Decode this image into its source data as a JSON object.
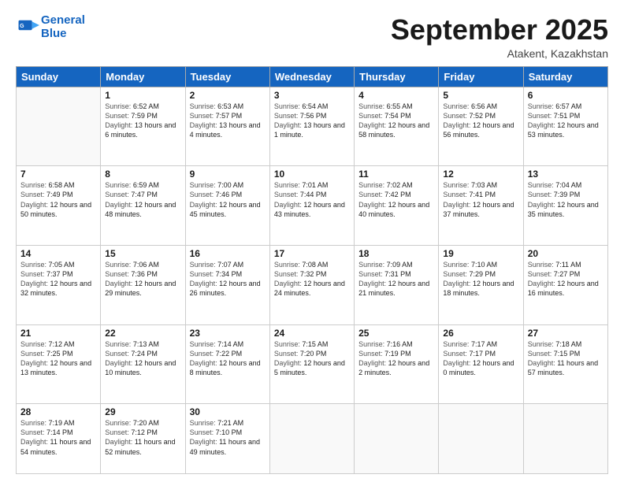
{
  "logo": {
    "line1": "General",
    "line2": "Blue"
  },
  "title": "September 2025",
  "subtitle": "Atakent, Kazakhstan",
  "weekdays": [
    "Sunday",
    "Monday",
    "Tuesday",
    "Wednesday",
    "Thursday",
    "Friday",
    "Saturday"
  ],
  "weeks": [
    [
      {
        "day": "",
        "sunrise": "",
        "sunset": "",
        "daylight": ""
      },
      {
        "day": "1",
        "sunrise": "6:52 AM",
        "sunset": "7:59 PM",
        "daylight": "13 hours and 6 minutes."
      },
      {
        "day": "2",
        "sunrise": "6:53 AM",
        "sunset": "7:57 PM",
        "daylight": "13 hours and 4 minutes."
      },
      {
        "day": "3",
        "sunrise": "6:54 AM",
        "sunset": "7:56 PM",
        "daylight": "13 hours and 1 minute."
      },
      {
        "day": "4",
        "sunrise": "6:55 AM",
        "sunset": "7:54 PM",
        "daylight": "12 hours and 58 minutes."
      },
      {
        "day": "5",
        "sunrise": "6:56 AM",
        "sunset": "7:52 PM",
        "daylight": "12 hours and 56 minutes."
      },
      {
        "day": "6",
        "sunrise": "6:57 AM",
        "sunset": "7:51 PM",
        "daylight": "12 hours and 53 minutes."
      }
    ],
    [
      {
        "day": "7",
        "sunrise": "6:58 AM",
        "sunset": "7:49 PM",
        "daylight": "12 hours and 50 minutes."
      },
      {
        "day": "8",
        "sunrise": "6:59 AM",
        "sunset": "7:47 PM",
        "daylight": "12 hours and 48 minutes."
      },
      {
        "day": "9",
        "sunrise": "7:00 AM",
        "sunset": "7:46 PM",
        "daylight": "12 hours and 45 minutes."
      },
      {
        "day": "10",
        "sunrise": "7:01 AM",
        "sunset": "7:44 PM",
        "daylight": "12 hours and 43 minutes."
      },
      {
        "day": "11",
        "sunrise": "7:02 AM",
        "sunset": "7:42 PM",
        "daylight": "12 hours and 40 minutes."
      },
      {
        "day": "12",
        "sunrise": "7:03 AM",
        "sunset": "7:41 PM",
        "daylight": "12 hours and 37 minutes."
      },
      {
        "day": "13",
        "sunrise": "7:04 AM",
        "sunset": "7:39 PM",
        "daylight": "12 hours and 35 minutes."
      }
    ],
    [
      {
        "day": "14",
        "sunrise": "7:05 AM",
        "sunset": "7:37 PM",
        "daylight": "12 hours and 32 minutes."
      },
      {
        "day": "15",
        "sunrise": "7:06 AM",
        "sunset": "7:36 PM",
        "daylight": "12 hours and 29 minutes."
      },
      {
        "day": "16",
        "sunrise": "7:07 AM",
        "sunset": "7:34 PM",
        "daylight": "12 hours and 26 minutes."
      },
      {
        "day": "17",
        "sunrise": "7:08 AM",
        "sunset": "7:32 PM",
        "daylight": "12 hours and 24 minutes."
      },
      {
        "day": "18",
        "sunrise": "7:09 AM",
        "sunset": "7:31 PM",
        "daylight": "12 hours and 21 minutes."
      },
      {
        "day": "19",
        "sunrise": "7:10 AM",
        "sunset": "7:29 PM",
        "daylight": "12 hours and 18 minutes."
      },
      {
        "day": "20",
        "sunrise": "7:11 AM",
        "sunset": "7:27 PM",
        "daylight": "12 hours and 16 minutes."
      }
    ],
    [
      {
        "day": "21",
        "sunrise": "7:12 AM",
        "sunset": "7:25 PM",
        "daylight": "12 hours and 13 minutes."
      },
      {
        "day": "22",
        "sunrise": "7:13 AM",
        "sunset": "7:24 PM",
        "daylight": "12 hours and 10 minutes."
      },
      {
        "day": "23",
        "sunrise": "7:14 AM",
        "sunset": "7:22 PM",
        "daylight": "12 hours and 8 minutes."
      },
      {
        "day": "24",
        "sunrise": "7:15 AM",
        "sunset": "7:20 PM",
        "daylight": "12 hours and 5 minutes."
      },
      {
        "day": "25",
        "sunrise": "7:16 AM",
        "sunset": "7:19 PM",
        "daylight": "12 hours and 2 minutes."
      },
      {
        "day": "26",
        "sunrise": "7:17 AM",
        "sunset": "7:17 PM",
        "daylight": "12 hours and 0 minutes."
      },
      {
        "day": "27",
        "sunrise": "7:18 AM",
        "sunset": "7:15 PM",
        "daylight": "11 hours and 57 minutes."
      }
    ],
    [
      {
        "day": "28",
        "sunrise": "7:19 AM",
        "sunset": "7:14 PM",
        "daylight": "11 hours and 54 minutes."
      },
      {
        "day": "29",
        "sunrise": "7:20 AM",
        "sunset": "7:12 PM",
        "daylight": "11 hours and 52 minutes."
      },
      {
        "day": "30",
        "sunrise": "7:21 AM",
        "sunset": "7:10 PM",
        "daylight": "11 hours and 49 minutes."
      },
      {
        "day": "",
        "sunrise": "",
        "sunset": "",
        "daylight": ""
      },
      {
        "day": "",
        "sunrise": "",
        "sunset": "",
        "daylight": ""
      },
      {
        "day": "",
        "sunrise": "",
        "sunset": "",
        "daylight": ""
      },
      {
        "day": "",
        "sunrise": "",
        "sunset": "",
        "daylight": ""
      }
    ]
  ],
  "labels": {
    "sunrise": "Sunrise:",
    "sunset": "Sunset:",
    "daylight": "Daylight:"
  }
}
